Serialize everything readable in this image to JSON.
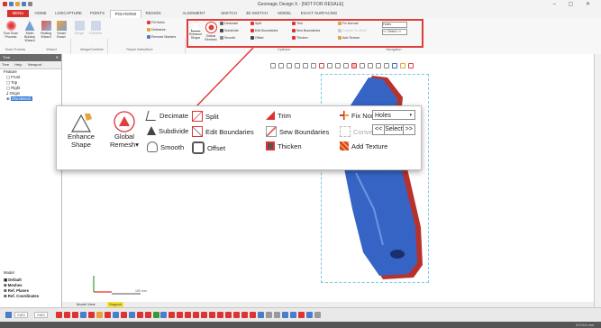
{
  "window": {
    "title": "Geomagic Design X - [NOT FOR RESALE]",
    "controls": "–  ▢  ✕"
  },
  "tabs": [
    "MENU",
    "HOME",
    "LIVECAPTURE",
    "POINTS",
    "POLYGONS",
    "REGION",
    "ALIGNMENT",
    "SKETCH",
    "3D SKETCH",
    "MODEL",
    "EXACT SURFACING"
  ],
  "ribbon": {
    "buttons": [
      "Run Scan Process",
      "Mesh Buildup Wizard",
      "Healing Wizard",
      "Smart Brush",
      "Merge",
      "Combine"
    ],
    "small": [
      "Fill Holes",
      "Defeature",
      "Remove Markers"
    ],
    "group_labels": [
      "Scan Process",
      "Wizard",
      "Merge/Combine",
      "Repair Holes/Bore",
      "Optimize",
      "Navigation"
    ],
    "boxed_small": [
      "Decimate",
      "Subdivide",
      "Smooth",
      "Split",
      "Edit Boundaries",
      "Offset",
      "Trim",
      "Sew Boundaries",
      "Thicken",
      "Fix Normal",
      "Convert To Mesh",
      "Add Texture",
      "Holes",
      "<<",
      "Select",
      ">>"
    ]
  },
  "left_panel": {
    "header": "Tree",
    "close": "✕",
    "tabs": [
      "Tree",
      "Help",
      "Viewport"
    ],
    "tree": [
      "Feature",
      "Front",
      "Top",
      "Right",
      "Origin",
      "SheetMesh"
    ],
    "model_label": "Model",
    "model_tree": [
      "Default",
      "Meshes",
      "Ref. Planes",
      "Ref. Coordinates"
    ]
  },
  "zoom": {
    "enhance": "Enhance Shape",
    "global": "Global Remesh",
    "decimate": "Decimate",
    "subdivide": "Subdivide",
    "smooth": "Smooth",
    "split": "Split",
    "edit_boundaries": "Edit Boundaries",
    "offset": "Offset",
    "trim": "Trim",
    "sew_boundaries": "Sew Boundaries",
    "thicken": "Thicken",
    "fix_normal": "Fix Normal",
    "convert_to_mesh": "Convert To Mesh",
    "add_texture": "Add Texture",
    "holes": "Holes",
    "prev": "<<",
    "select": "Select",
    "next": ">>"
  },
  "viewport": {
    "scale_label": "100 mm"
  },
  "bottom_tabs": [
    "Model View",
    "Support"
  ],
  "status": {
    "auto1": "Auto",
    "auto2": "Auto",
    "right": "0:0:0:0 mm"
  },
  "colors": {
    "menu_red": "#d8322d",
    "mesh_blue": "#3766c8",
    "mesh_red": "#b8322d",
    "highlight_red": "#e03c3c"
  }
}
